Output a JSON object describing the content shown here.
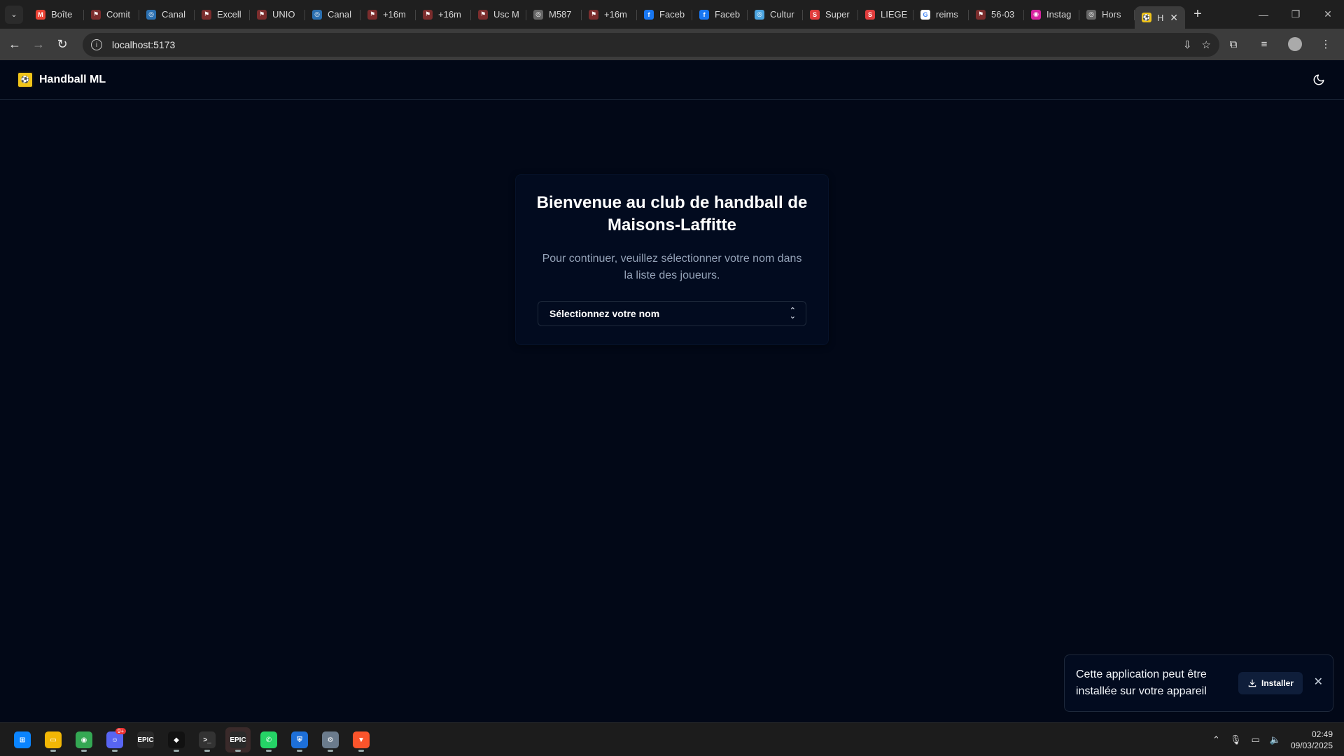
{
  "browser": {
    "tabs": [
      {
        "title": "Boîte",
        "favicon": "gmail-icon",
        "color": "#ea4335",
        "glyph": "M"
      },
      {
        "title": "Comit",
        "favicon": "handball-icon",
        "color": "#7b2d2d",
        "glyph": "⚑"
      },
      {
        "title": "Canal",
        "favicon": "globe-icon",
        "color": "#2a6fb0",
        "glyph": "◎"
      },
      {
        "title": "Excell",
        "favicon": "handball-icon",
        "color": "#7b2d2d",
        "glyph": "⚑"
      },
      {
        "title": "UNIO",
        "favicon": "handball-icon",
        "color": "#7b2d2d",
        "glyph": "⚑"
      },
      {
        "title": "Canal",
        "favicon": "globe-icon",
        "color": "#2a6fb0",
        "glyph": "◎"
      },
      {
        "title": "+16m",
        "favicon": "handball-icon",
        "color": "#7b2d2d",
        "glyph": "⚑"
      },
      {
        "title": "+16m",
        "favicon": "handball-icon",
        "color": "#7b2d2d",
        "glyph": "⚑"
      },
      {
        "title": "Usc M",
        "favicon": "handball-icon",
        "color": "#7b2d2d",
        "glyph": "⚑"
      },
      {
        "title": "M587",
        "favicon": "globe-icon",
        "color": "#666",
        "glyph": "◎"
      },
      {
        "title": "+16m",
        "favicon": "handball-icon",
        "color": "#7b2d2d",
        "glyph": "⚑"
      },
      {
        "title": "Faceb",
        "favicon": "facebook-icon",
        "color": "#1877f2",
        "glyph": "f"
      },
      {
        "title": "Faceb",
        "favicon": "facebook-icon",
        "color": "#1877f2",
        "glyph": "f"
      },
      {
        "title": "Cultur",
        "favicon": "globe-icon",
        "color": "#4aa3df",
        "glyph": "◎"
      },
      {
        "title": "Super",
        "favicon": "super-icon",
        "color": "#e03c3c",
        "glyph": "S"
      },
      {
        "title": "LIEGE",
        "favicon": "super-icon",
        "color": "#e03c3c",
        "glyph": "S"
      },
      {
        "title": "reims",
        "favicon": "google-icon",
        "color": "#ffffff",
        "glyph": "G"
      },
      {
        "title": "56-03",
        "favicon": "handball-icon",
        "color": "#7b2d2d",
        "glyph": "⚑"
      },
      {
        "title": "Instag",
        "favicon": "instagram-icon",
        "color": "#d6249f",
        "glyph": "◉"
      },
      {
        "title": "Hors",
        "favicon": "globe-icon",
        "color": "#666",
        "glyph": "◎"
      }
    ],
    "active_tab": {
      "title": "H",
      "favicon": "handball-ml-icon"
    },
    "url": "localhost:5173"
  },
  "app": {
    "brand": "Handball ML",
    "welcome_title": "Bienvenue au club de handball de Maisons-Laffitte",
    "welcome_text": "Pour continuer, veuillez sélectionner votre nom dans la liste des joueurs.",
    "select_placeholder": "Sélectionnez votre nom",
    "toast_message": "Cette application peut être installée sur votre appareil",
    "install_label": "Installer"
  },
  "taskbar": {
    "apps": [
      {
        "name": "windows-start-icon",
        "color": "#0a84ff",
        "glyph": "⊞",
        "dot": false
      },
      {
        "name": "file-explorer-icon",
        "color": "#f2b705",
        "glyph": "▭",
        "dot": true
      },
      {
        "name": "chrome-icon",
        "color": "#34a853",
        "glyph": "◉",
        "dot": true
      },
      {
        "name": "discord-icon",
        "color": "#5865f2",
        "glyph": "☺",
        "dot": true,
        "badge": "9+"
      },
      {
        "name": "epic-games-icon",
        "color": "#2a2a2a",
        "glyph": "EPIC",
        "dot": false
      },
      {
        "name": "unity-icon",
        "color": "#111111",
        "glyph": "◆",
        "dot": true
      },
      {
        "name": "terminal-icon",
        "color": "#333333",
        "glyph": ">_",
        "dot": true
      },
      {
        "name": "epic-games-launcher-icon",
        "color": "#2a2a2a",
        "glyph": "EPIC",
        "dot": true,
        "active": true
      },
      {
        "name": "whatsapp-icon",
        "color": "#25d366",
        "glyph": "✆",
        "dot": true
      },
      {
        "name": "rocket-league-icon",
        "color": "#1d6fd8",
        "glyph": "⛨",
        "dot": true
      },
      {
        "name": "settings-icon",
        "color": "#6b7b8c",
        "glyph": "⚙",
        "dot": true
      },
      {
        "name": "brave-icon",
        "color": "#fb542b",
        "glyph": "▼",
        "dot": true
      }
    ],
    "time": "02:49",
    "date": "09/03/2025"
  }
}
